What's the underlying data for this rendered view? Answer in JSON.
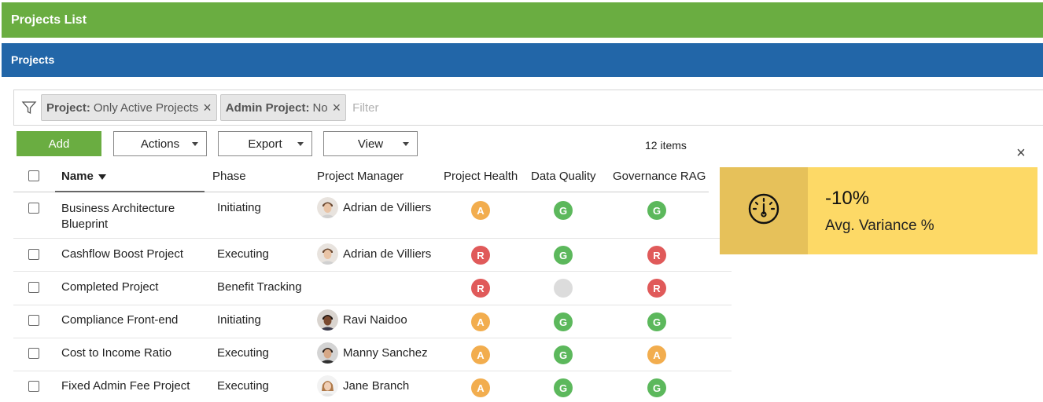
{
  "header": {
    "title": "Projects List"
  },
  "section": {
    "title": "Projects"
  },
  "filters": {
    "chips": [
      {
        "key": "Project:",
        "value": "Only Active Projects"
      },
      {
        "key": "Admin Project:",
        "value": "No"
      }
    ],
    "placeholder": "Filter"
  },
  "toolbar": {
    "add_label": "Add",
    "actions_label": "Actions",
    "export_label": "Export",
    "view_label": "View",
    "item_count": "12 items"
  },
  "table": {
    "columns": {
      "name": "Name",
      "phase": "Phase",
      "manager": "Project Manager",
      "health": "Project Health",
      "quality": "Data Quality",
      "governance": "Governance RAG"
    },
    "rows": [
      {
        "name_line1": "Business Architecture",
        "name_line2": "Blueprint",
        "phase": "Initiating",
        "manager": "Adrian de Villiers",
        "health": "A",
        "quality": "G",
        "governance": "G"
      },
      {
        "name_line1": "Cashflow Boost Project",
        "name_line2": "",
        "phase": "Executing",
        "manager": "Adrian de Villiers",
        "health": "R",
        "quality": "G",
        "governance": "R"
      },
      {
        "name_line1": "Completed Project",
        "name_line2": "",
        "phase": "Benefit Tracking",
        "manager": "",
        "health": "R",
        "quality": "",
        "governance": "R"
      },
      {
        "name_line1": "Compliance Front-end",
        "name_line2": "",
        "phase": "Initiating",
        "manager": "Ravi Naidoo",
        "health": "A",
        "quality": "G",
        "governance": "G"
      },
      {
        "name_line1": "Cost to Income Ratio",
        "name_line2": "",
        "phase": "Executing",
        "manager": "Manny Sanchez",
        "health": "A",
        "quality": "G",
        "governance": "A"
      },
      {
        "name_line1": "Fixed Admin Fee Project",
        "name_line2": "",
        "phase": "Executing",
        "manager": "Jane Branch",
        "health": "A",
        "quality": "G",
        "governance": "G"
      }
    ]
  },
  "kpi": {
    "value": "-10%",
    "label": "Avg. Variance %",
    "icon": "gauge-icon"
  },
  "colors": {
    "green": "#6aad41",
    "blue": "#2266a8",
    "rag_red": "#e05a5a",
    "rag_amber": "#f2ad4e",
    "rag_green": "#5cb85c",
    "rag_grey": "#dcdcdc",
    "kpi_bg": "#fdd966"
  }
}
